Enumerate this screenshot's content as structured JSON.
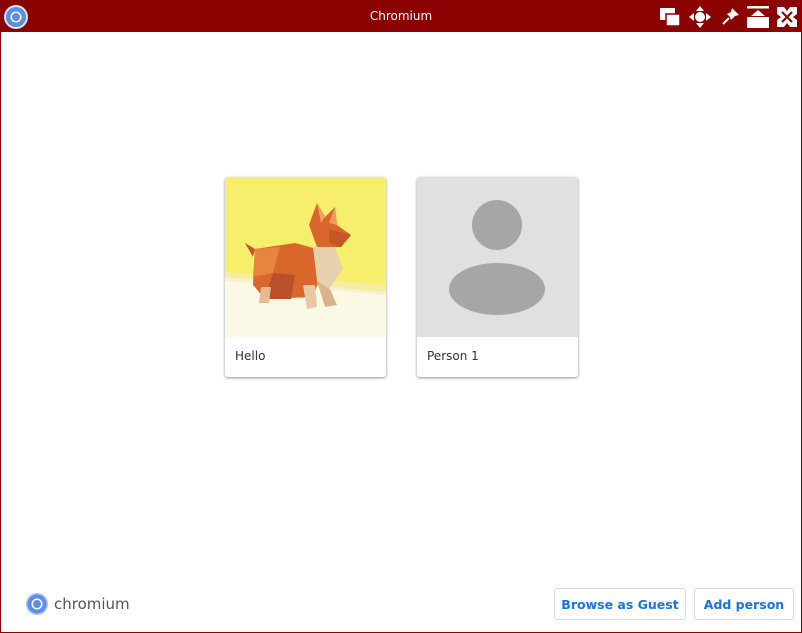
{
  "window": {
    "title": "Chromium",
    "controls": [
      "windows-icon",
      "move-icon",
      "pin-icon",
      "maximize-icon",
      "close-icon"
    ]
  },
  "profiles": [
    {
      "name": "Hello",
      "avatar": "origami-corgi"
    },
    {
      "name": "Person 1",
      "avatar": "default-person-silhouette"
    }
  ],
  "footer": {
    "brand": "chromium",
    "guest_label": "Browse as Guest",
    "add_label": "Add person"
  },
  "colors": {
    "titlebar": "#8b0000",
    "accent": "#1a73e8",
    "card_placeholder": "#e0e0e0",
    "silhouette": "#a6a6a6"
  }
}
